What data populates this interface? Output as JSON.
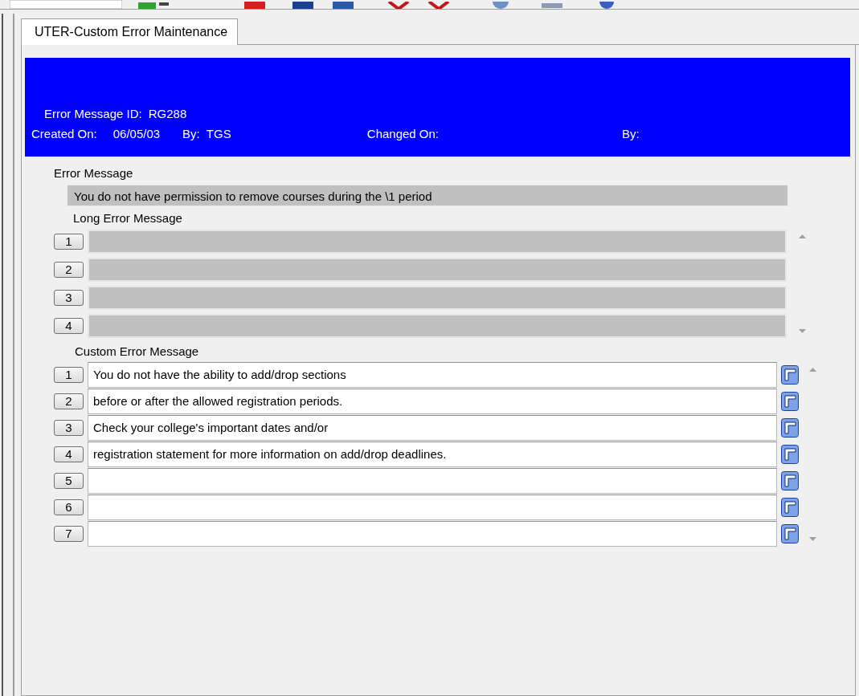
{
  "tab": {
    "label": "UTER-Custom Error Maintenance",
    "selected": true
  },
  "header": {
    "id_label": "Error Message ID:",
    "id_value": "RG288",
    "created_label": "Created On:",
    "created_value": "06/05/03",
    "created_by_label": "By:",
    "created_by_value": "TGS",
    "changed_label": "Changed On:",
    "changed_by_label": "By:"
  },
  "error_message": {
    "label": "Error Message",
    "value": "You do not have permission to remove courses during the \\1 period"
  },
  "long_error_message": {
    "label": "Long Error Message",
    "rows": [
      {
        "number": "1"
      },
      {
        "number": "2"
      },
      {
        "number": "3"
      },
      {
        "number": "4"
      }
    ]
  },
  "custom_error_message": {
    "label": "Custom Error Message",
    "rows": [
      {
        "number": "1",
        "value": "You do not have the ability to add/drop sections"
      },
      {
        "number": "2",
        "value": "before or after the allowed registration periods."
      },
      {
        "number": "3",
        "value": "Check your college's important dates and/or"
      },
      {
        "number": "4",
        "value": "registration statement for more information on add/drop deadlines."
      },
      {
        "number": "5"
      },
      {
        "number": "6"
      },
      {
        "number": "7"
      }
    ]
  }
}
